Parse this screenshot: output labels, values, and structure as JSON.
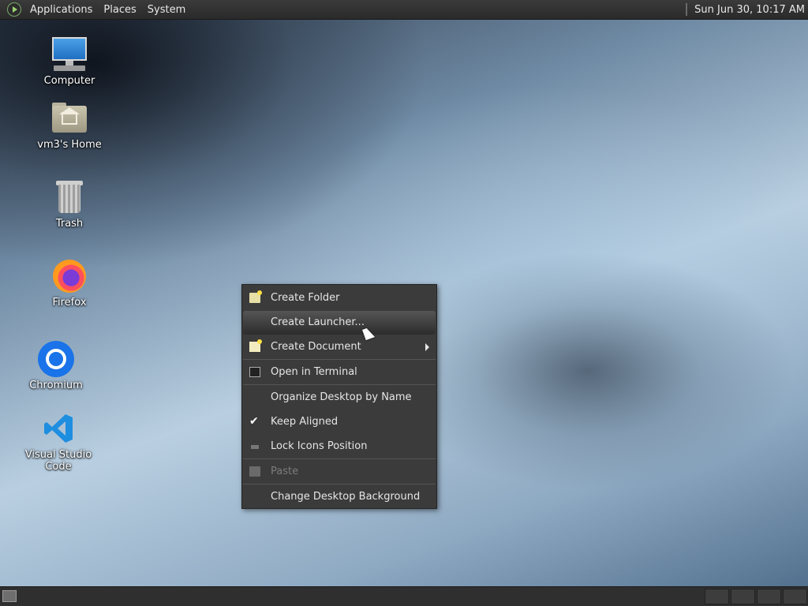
{
  "topbar": {
    "menus": [
      "Applications",
      "Places",
      "System"
    ],
    "clock": "Sun Jun 30, 10:17 AM"
  },
  "desktop_icons": [
    {
      "label": "Computer",
      "icon": "computer-icon"
    },
    {
      "label": "vm3's Home",
      "icon": "home-folder-icon"
    },
    {
      "label": "Trash",
      "icon": "trash-icon"
    },
    {
      "label": "Firefox",
      "icon": "firefox-icon"
    },
    {
      "label": "Chromium",
      "icon": "chromium-icon"
    },
    {
      "label": "Visual Studio Code",
      "icon": "vscode-icon"
    }
  ],
  "context_menu": {
    "items": [
      {
        "label": "Create Folder",
        "icon": "new-folder-icon"
      },
      {
        "label": "Create Launcher...",
        "highlighted": true
      },
      {
        "label": "Create Document",
        "icon": "new-document-icon",
        "submenu": true
      },
      {
        "label": "Open in Terminal",
        "icon": "terminal-icon"
      },
      {
        "label": "Organize Desktop by Name"
      },
      {
        "label": "Keep Aligned",
        "checked": true
      },
      {
        "label": "Lock Icons Position",
        "icon": "lock-icon"
      },
      {
        "label": "Paste",
        "icon": "paste-icon",
        "disabled": true
      },
      {
        "label": "Change Desktop Background"
      }
    ]
  },
  "colors": {
    "panel_bg": "#2f2f2f",
    "menu_bg": "#3b3b3b",
    "menu_highlight": "#444444",
    "menu_text": "#e6e6e6",
    "menu_disabled_text": "#7c7c7c"
  }
}
